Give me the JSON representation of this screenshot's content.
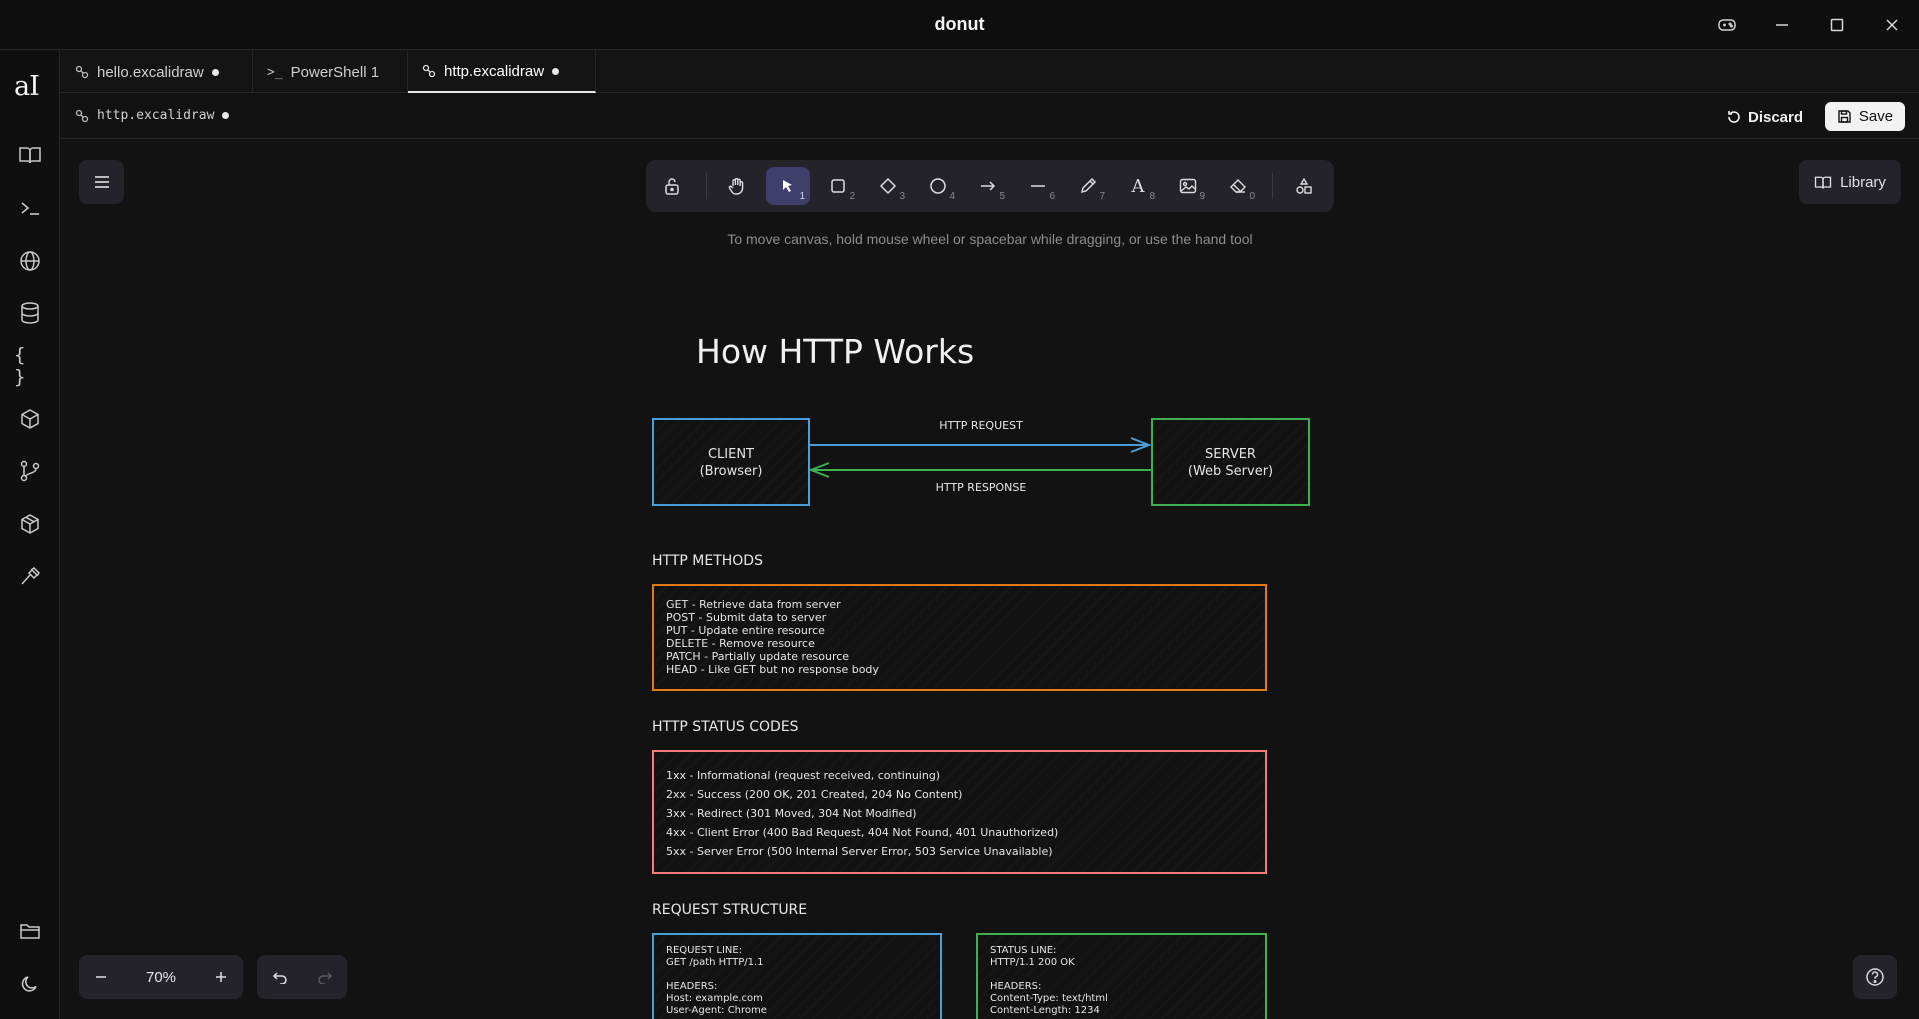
{
  "window": {
    "title": "donut"
  },
  "sidebar": {
    "logo": "aI",
    "items": [
      {
        "name": "docs"
      },
      {
        "name": "terminal"
      },
      {
        "name": "web"
      },
      {
        "name": "database"
      },
      {
        "name": "json"
      },
      {
        "name": "package"
      },
      {
        "name": "git"
      },
      {
        "name": "box"
      },
      {
        "name": "tools"
      }
    ]
  },
  "tabs": [
    {
      "label": "hello.excalidraw",
      "modified": true,
      "icon": "link-icon"
    },
    {
      "label": "PowerShell 1",
      "modified": false,
      "icon": "terminal-icon"
    },
    {
      "label": "http.excalidraw",
      "modified": true,
      "icon": "link-icon",
      "active": true
    }
  ],
  "file": {
    "name": "http.excalidraw",
    "discard_label": "Discard",
    "save_label": "Save"
  },
  "toolbar": {
    "tools": [
      {
        "name": "lock",
        "key": ""
      },
      {
        "name": "hand",
        "key": ""
      },
      {
        "name": "selection",
        "key": "1"
      },
      {
        "name": "rectangle",
        "key": "2"
      },
      {
        "name": "diamond",
        "key": "3"
      },
      {
        "name": "ellipse",
        "key": "4"
      },
      {
        "name": "arrow",
        "key": "5"
      },
      {
        "name": "line",
        "key": "6"
      },
      {
        "name": "draw",
        "key": "7"
      },
      {
        "name": "text",
        "key": "8"
      },
      {
        "name": "image",
        "key": "9"
      },
      {
        "name": "eraser",
        "key": "0"
      },
      {
        "name": "extra-tools",
        "key": ""
      }
    ],
    "hint": "To move canvas, hold mouse wheel or spacebar while dragging, or use the hand tool"
  },
  "library_label": "Library",
  "zoom": {
    "value": "70%"
  },
  "diagram": {
    "title": "How HTTP Works",
    "client_label": "CLIENT\n(Browser)",
    "server_label": "SERVER\n(Web Server)",
    "request_label": "HTTP REQUEST",
    "response_label": "HTTP RESPONSE",
    "methods_heading": "HTTP METHODS",
    "methods": [
      "GET - Retrieve data from server",
      "POST - Submit data to server",
      "PUT - Update entire resource",
      "DELETE - Remove resource",
      "PATCH - Partially update resource",
      "HEAD - Like GET but no response body"
    ],
    "status_heading": "HTTP STATUS CODES",
    "status_codes": [
      "1xx - Informational (request received, continuing)",
      "2xx - Success (200 OK, 201 Created, 204 No Content)",
      "3xx - Redirect (301 Moved, 304 Not Modified)",
      "4xx - Client Error (400 Bad Request, 404 Not Found, 401 Unauthorized)",
      "5xx - Server Error (500 Internal Server Error, 503 Service Unavailable)"
    ],
    "request_structure_heading": "REQUEST STRUCTURE",
    "request_box": "REQUEST LINE:\nGET /path HTTP/1.1\n\nHEADERS:\nHost: example.com\nUser-Agent: Chrome",
    "response_box": "STATUS LINE:\nHTTP/1.1 200 OK\n\nHEADERS:\nContent-Type: text/html\nContent-Length: 1234"
  },
  "colors": {
    "client": "#4a9eda",
    "server": "#3fb04f",
    "methods": "#e07b17",
    "status": "#f47a7a",
    "accent": "#403e6a"
  }
}
